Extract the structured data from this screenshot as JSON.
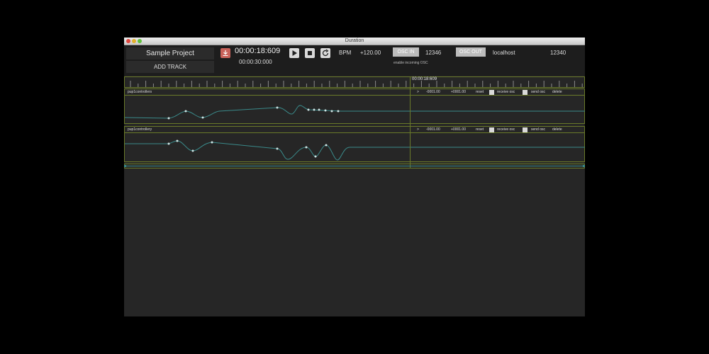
{
  "window": {
    "title": "Duration"
  },
  "header": {
    "project_name": "Sample Project",
    "add_track": "ADD TRACK",
    "timecode": "00:00:18:609",
    "duration": "00:00:30:000",
    "bpm_label": "BPM",
    "bpm_value": "+120.00",
    "osc_in_label": "OSC IN",
    "osc_in_port": "12346",
    "osc_in_hint": "enable incoming OSC",
    "osc_out_label": "OSC OUT",
    "osc_out_host": "localhost",
    "osc_out_port": "12340"
  },
  "timeline": {
    "playhead_time": "00:00:18:609"
  },
  "tracks": [
    {
      "name": "pup1controllers",
      "arrow": ">",
      "min": "-0001.00",
      "max": "+0001.00",
      "reset": "reset",
      "receive": "receive osc",
      "send": "send osc",
      "delete": "delete"
    },
    {
      "name": "pup1controllery",
      "arrow": ">",
      "min": "-0001.00",
      "max": "+0001.00",
      "reset": "reset",
      "receive": "receive osc",
      "send": "send osc",
      "delete": "delete"
    }
  ],
  "colors": {
    "curve": "#3a8a8a",
    "track_border": "#6a7a2a",
    "background": "#262626"
  },
  "icons": [
    "save-icon",
    "play-icon",
    "stop-icon",
    "loop-icon"
  ]
}
